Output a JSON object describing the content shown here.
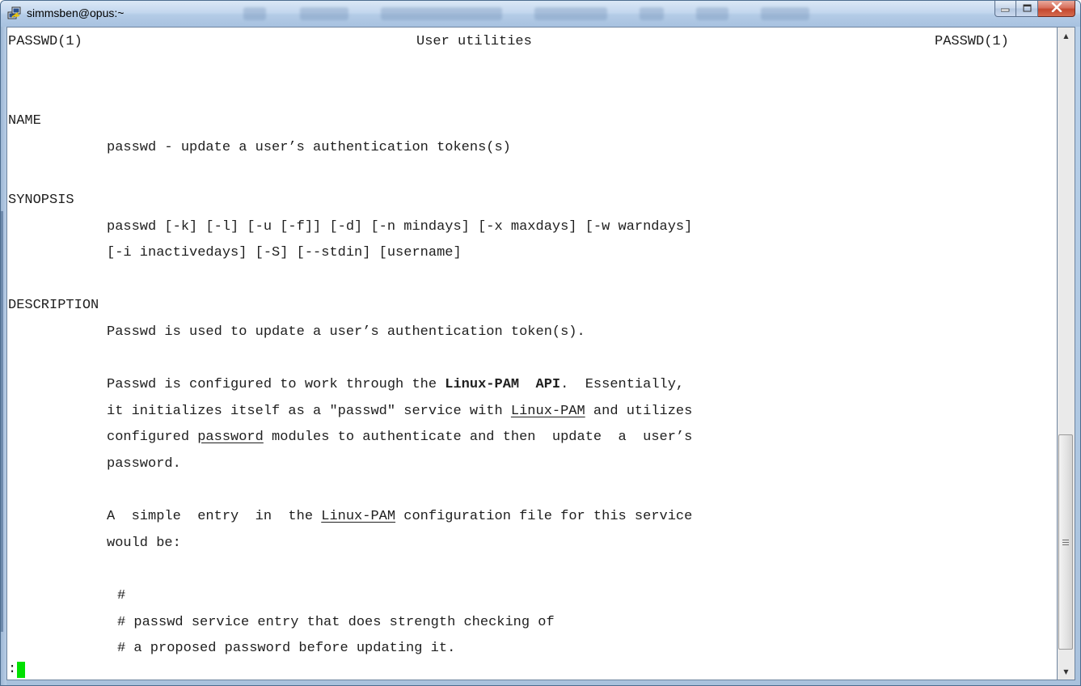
{
  "window": {
    "title": "simmsben@opus:~",
    "icon": "putty-icon",
    "controls": [
      "minimize-icon",
      "maximize-icon",
      "close-icon"
    ]
  },
  "terminal": {
    "header_left": "PASSWD(1)",
    "header_center": "User utilities",
    "header_right": "PASSWD(1)",
    "name_heading": "NAME",
    "name_text": "passwd - update a user’s authentication tokens(s)",
    "synopsis_heading": "SYNOPSIS",
    "synopsis_line1": "passwd [-k] [-l] [-u [-f]] [-d] [-n mindays] [-x maxdays] [-w warndays]",
    "synopsis_line2": "[-i inactivedays] [-S] [--stdin] [username]",
    "description_heading": "DESCRIPTION",
    "desc_p1": "Passwd is used to update a user’s authentication token(s).",
    "desc_p2_l1a": "Passwd is configured to work through the ",
    "desc_p2_l1b": "Linux-PAM  API",
    "desc_p2_l1c": ".  Essentially,",
    "desc_p2_l2a": "it initializes itself as a \"passwd\" service with ",
    "desc_p2_l2b": "Linux-PAM",
    "desc_p2_l2c": " and utilizes",
    "desc_p2_l3a": "configured ",
    "desc_p2_l3b": "password",
    "desc_p2_l3c": " modules to authenticate and then  update  a  user’s",
    "desc_p2_l4": "password.",
    "desc_p3_l1a": "A  simple  entry  in  the ",
    "desc_p3_l1b": "Linux-PAM",
    "desc_p3_l1c": " configuration file for this service",
    "desc_p3_l2": "would be:",
    "code_l1": "#",
    "code_l2": "# passwd service entry that does strength checking of",
    "code_l3": "# a proposed password before updating it.",
    "prompt": ":"
  },
  "scrollbar": {
    "up_glyph": "▲",
    "down_glyph": "▼",
    "position": 0.72
  }
}
